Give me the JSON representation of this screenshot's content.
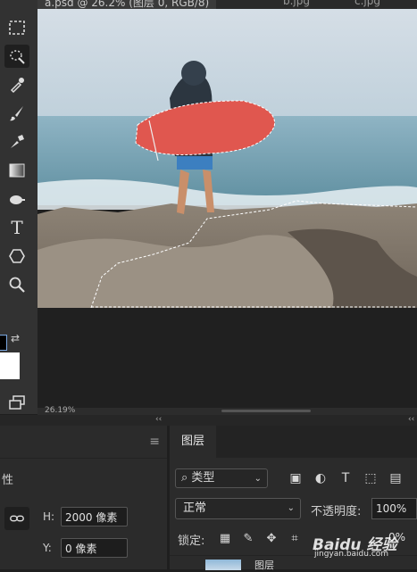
{
  "document_tabs": [
    {
      "label": "a.psd @ 26.2% (图层 0, RGB/8)",
      "active": true
    },
    {
      "label": "b.jpg",
      "active": false
    },
    {
      "label": "c.jpg",
      "active": false
    }
  ],
  "tools": [
    {
      "name": "marquee-tool",
      "icon": "rect-marquee-icon"
    },
    {
      "name": "quick-selection-tool",
      "icon": "quick-selection-icon",
      "selected": true
    },
    {
      "name": "eyedropper-tool",
      "icon": "eyedropper-icon"
    },
    {
      "name": "brush-tool",
      "icon": "brush-icon"
    },
    {
      "name": "clone-stamp-tool",
      "icon": "stamp-icon"
    },
    {
      "name": "gradient-tool",
      "icon": "gradient-icon"
    },
    {
      "name": "burn-tool",
      "icon": "burn-icon"
    },
    {
      "name": "type-tool",
      "icon": "type-icon",
      "glyph": "T"
    },
    {
      "name": "shape-tool",
      "icon": "hexagon-icon"
    },
    {
      "name": "zoom-tool",
      "icon": "zoom-icon"
    }
  ],
  "statusbar": {
    "zoom_text": "26.19%"
  },
  "properties": {
    "title": "性",
    "h_label": "H:",
    "h_value": "2000 像素",
    "y_label": "Y:",
    "y_value": "0 像素"
  },
  "layers": {
    "tab_label": "图层",
    "filter_label": "类型",
    "blend_mode": "正常",
    "opacity_label": "不透明度:",
    "opacity_value": "100%",
    "lock_label": "锁定:",
    "fill_value": "0%",
    "layer_name": "图层"
  },
  "watermark": {
    "text": "Baidu 经验",
    "sub": "jingyan.baidu.com"
  },
  "colors": {
    "ui_bg": "#1f1f1f",
    "panel": "#2b2b2b",
    "toolbar": "#323232",
    "board": "#e0574f"
  }
}
